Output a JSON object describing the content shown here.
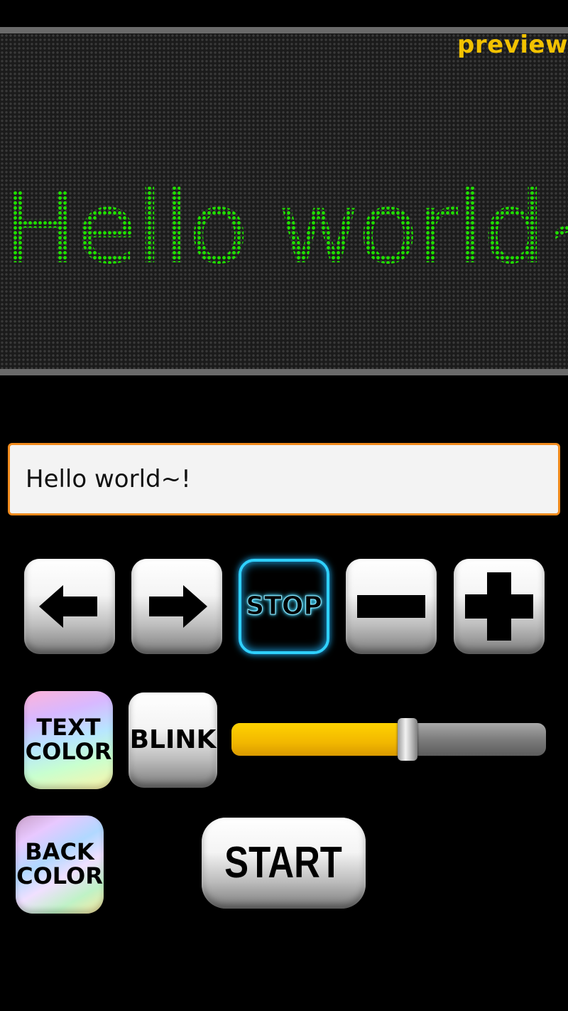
{
  "preview": {
    "label": "preview",
    "display_text": "Hello world~!",
    "text_color": "#1fe000"
  },
  "input": {
    "value": "Hello world~!",
    "border_color": "#f08a1c"
  },
  "controls": {
    "scroll_left_icon": "arrow-left-icon",
    "scroll_right_icon": "arrow-right-icon",
    "stop_label": "STOP",
    "size_down_icon": "minus-icon",
    "size_up_icon": "plus-icon",
    "text_color_label_1": "TEXT",
    "text_color_label_2": "COLOR",
    "blink_label": "BLINK",
    "back_color_label_1": "BACK",
    "back_color_label_2": "COLOR",
    "start_label": "START"
  },
  "speed_slider": {
    "value_fraction": 0.56,
    "fill_color": "#f2b700"
  }
}
